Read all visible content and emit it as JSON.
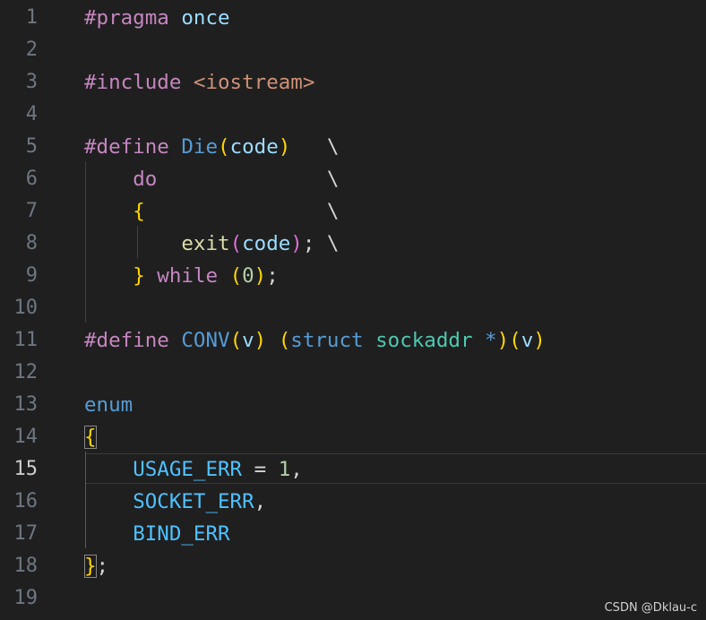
{
  "colors": {
    "background": "#1f1f1f",
    "line_number": "#6e7681",
    "line_number_active": "#cccccc",
    "keyword_purple": "#c586c0",
    "keyword_blue": "#569cd6",
    "identifier": "#9cdcfe",
    "function": "#dcdcaa",
    "macro": "#4fc1ff",
    "type": "#4ec9b0",
    "string": "#ce9178",
    "number": "#b5cea8",
    "text": "#d4d4d4",
    "bracket_gold": "#ffd700",
    "bracket_pink": "#da70d6",
    "bracket_blue": "#179fff"
  },
  "editor": {
    "active_line": 15,
    "lines": [
      {
        "number": "1",
        "tokens": [
          {
            "t": "#pragma ",
            "c": "#c586c0"
          },
          {
            "t": "once",
            "c": "#9cdcfe"
          }
        ]
      },
      {
        "number": "2",
        "tokens": []
      },
      {
        "number": "3",
        "tokens": [
          {
            "t": "#include ",
            "c": "#c586c0"
          },
          {
            "t": "<iostream>",
            "c": "#ce9178"
          }
        ]
      },
      {
        "number": "4",
        "tokens": []
      },
      {
        "number": "5",
        "tokens": [
          {
            "t": "#define ",
            "c": "#c586c0"
          },
          {
            "t": "Die",
            "c": "#569cd6"
          },
          {
            "t": "(",
            "c": "#ffd700"
          },
          {
            "t": "code",
            "c": "#9cdcfe"
          },
          {
            "t": ")",
            "c": "#ffd700"
          },
          {
            "t": "   \\",
            "c": "#d4d4d4"
          }
        ]
      },
      {
        "number": "6",
        "tokens": [
          {
            "t": "    ",
            "c": "#d4d4d4"
          },
          {
            "t": "do",
            "c": "#c586c0"
          },
          {
            "t": "              \\",
            "c": "#d4d4d4"
          }
        ]
      },
      {
        "number": "7",
        "tokens": [
          {
            "t": "    ",
            "c": "#d4d4d4"
          },
          {
            "t": "{",
            "c": "#ffd700"
          },
          {
            "t": "               \\",
            "c": "#d4d4d4"
          }
        ]
      },
      {
        "number": "8",
        "tokens": [
          {
            "t": "        ",
            "c": "#d4d4d4"
          },
          {
            "t": "exit",
            "c": "#dcdcaa"
          },
          {
            "t": "(",
            "c": "#da70d6"
          },
          {
            "t": "code",
            "c": "#9cdcfe"
          },
          {
            "t": ")",
            "c": "#da70d6"
          },
          {
            "t": "; \\",
            "c": "#d4d4d4"
          }
        ]
      },
      {
        "number": "9",
        "tokens": [
          {
            "t": "    ",
            "c": "#d4d4d4"
          },
          {
            "t": "}",
            "c": "#ffd700"
          },
          {
            "t": " ",
            "c": "#d4d4d4"
          },
          {
            "t": "while",
            "c": "#c586c0"
          },
          {
            "t": " ",
            "c": "#d4d4d4"
          },
          {
            "t": "(",
            "c": "#ffd700"
          },
          {
            "t": "0",
            "c": "#b5cea8"
          },
          {
            "t": ")",
            "c": "#ffd700"
          },
          {
            "t": ";",
            "c": "#d4d4d4"
          }
        ]
      },
      {
        "number": "10",
        "tokens": []
      },
      {
        "number": "11",
        "tokens": [
          {
            "t": "#define ",
            "c": "#c586c0"
          },
          {
            "t": "CONV",
            "c": "#569cd6"
          },
          {
            "t": "(",
            "c": "#ffd700"
          },
          {
            "t": "v",
            "c": "#9cdcfe"
          },
          {
            "t": ")",
            "c": "#ffd700"
          },
          {
            "t": " ",
            "c": "#d4d4d4"
          },
          {
            "t": "(",
            "c": "#ffd700"
          },
          {
            "t": "struct",
            "c": "#569cd6"
          },
          {
            "t": " ",
            "c": "#d4d4d4"
          },
          {
            "t": "sockaddr",
            "c": "#4ec9b0"
          },
          {
            "t": " ",
            "c": "#d4d4d4"
          },
          {
            "t": "*",
            "c": "#569cd6"
          },
          {
            "t": ")",
            "c": "#ffd700"
          },
          {
            "t": "(",
            "c": "#ffd700"
          },
          {
            "t": "v",
            "c": "#9cdcfe"
          },
          {
            "t": ")",
            "c": "#ffd700"
          }
        ]
      },
      {
        "number": "12",
        "tokens": []
      },
      {
        "number": "13",
        "tokens": [
          {
            "t": "enum",
            "c": "#569cd6"
          }
        ]
      },
      {
        "number": "14",
        "tokens": [
          {
            "t": "{",
            "c": "#ffd700",
            "box": true
          }
        ]
      },
      {
        "number": "15",
        "tokens": [
          {
            "t": "    ",
            "c": "#d4d4d4"
          },
          {
            "t": "USAGE_ERR",
            "c": "#4fc1ff"
          },
          {
            "t": " = ",
            "c": "#d4d4d4"
          },
          {
            "t": "1",
            "c": "#b5cea8"
          },
          {
            "t": ",",
            "c": "#d4d4d4"
          }
        ]
      },
      {
        "number": "16",
        "tokens": [
          {
            "t": "    ",
            "c": "#d4d4d4"
          },
          {
            "t": "SOCKET_ERR",
            "c": "#4fc1ff"
          },
          {
            "t": ",",
            "c": "#d4d4d4"
          }
        ]
      },
      {
        "number": "17",
        "tokens": [
          {
            "t": "    ",
            "c": "#d4d4d4"
          },
          {
            "t": "BIND_ERR",
            "c": "#4fc1ff"
          }
        ]
      },
      {
        "number": "18",
        "tokens": [
          {
            "t": "}",
            "c": "#ffd700",
            "box": true
          },
          {
            "t": ";",
            "c": "#d4d4d4"
          }
        ]
      },
      {
        "number": "19",
        "tokens": []
      }
    ]
  },
  "watermark": "CSDN @Dklau-c"
}
